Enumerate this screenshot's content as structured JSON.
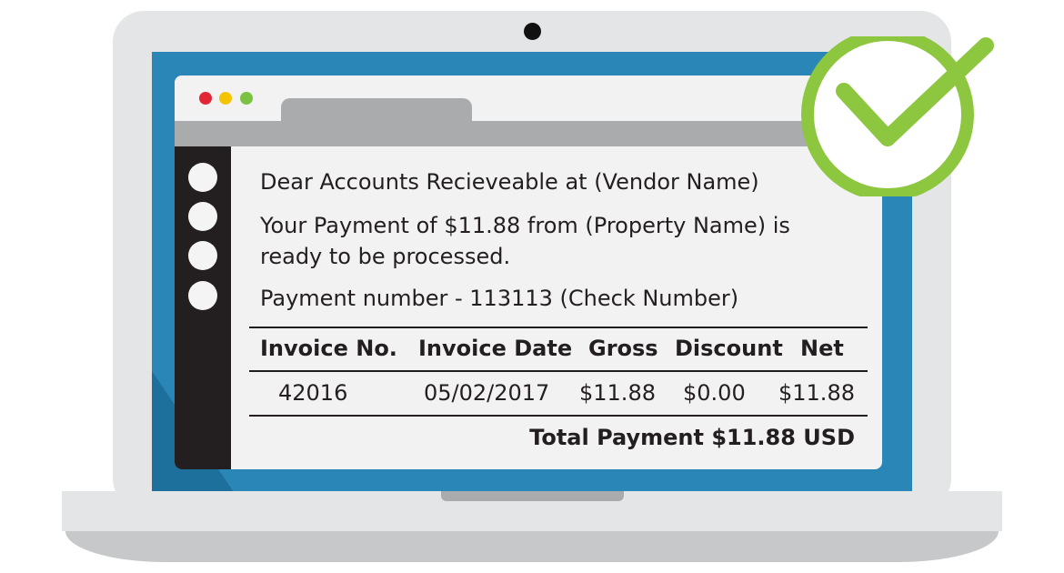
{
  "email": {
    "greeting": "Dear Accounts Recieveable at (Vendor Name)",
    "message_line1": "Your Payment of $11.88 from (Property Name) is",
    "message_line2": "ready to be processed.",
    "payment_number": "Payment number - 113113 (Check Number)"
  },
  "table": {
    "headers": [
      "Invoice No.",
      "Invoice Date",
      "Gross",
      "Discount",
      "Net"
    ],
    "rows": [
      [
        "42016",
        "05/02/2017",
        "$11.88",
        "$0.00",
        "$11.88"
      ]
    ],
    "total": "Total Payment $11.88 USD"
  },
  "icons": {
    "window_controls": [
      "close-dot",
      "minimize-dot",
      "maximize-dot"
    ],
    "badge": "checkmark-icon"
  },
  "colors": {
    "screen": "#2a86b7",
    "sidebar": "#231f20",
    "check": "#8dc63f",
    "dot_red": "#e32636",
    "dot_yellow": "#f5c400",
    "dot_green": "#7cc242"
  }
}
